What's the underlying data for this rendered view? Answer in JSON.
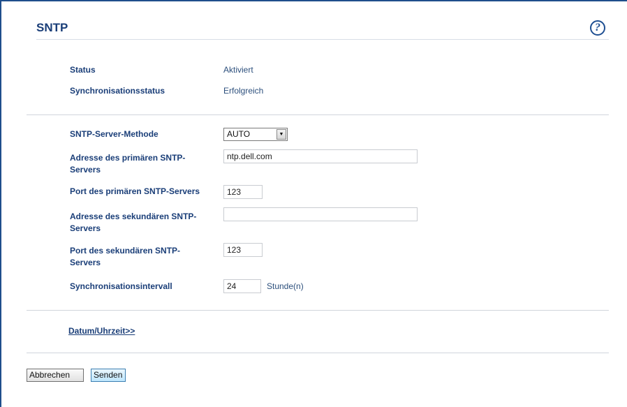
{
  "page": {
    "title": "SNTP",
    "help_icon": "question-circle-icon",
    "help_glyph": "?"
  },
  "status_section": {
    "status_label": "Status",
    "status_value": "Aktiviert",
    "sync_status_label": "Synchronisationsstatus",
    "sync_status_value": "Erfolgreich"
  },
  "form": {
    "method_label": "SNTP-Server-Methode",
    "method_value": "AUTO",
    "primary_address_label_1": "Adresse des primären SNTP-",
    "primary_address_label_2": "Servers",
    "primary_address_value": "ntp.dell.com",
    "primary_port_label": "Port des primären SNTP-Servers",
    "primary_port_value": "123",
    "secondary_address_label_1": "Adresse des sekundären SNTP-",
    "secondary_address_label_2": "Servers",
    "secondary_address_value": "",
    "secondary_port_label_1": "Port des sekundären SNTP-",
    "secondary_port_label_2": "Servers",
    "secondary_port_value": "123",
    "interval_label": "Synchronisationsintervall",
    "interval_value": "24",
    "interval_unit": "Stunde(n)"
  },
  "links": {
    "datetime": "Datum/Uhrzeit>>"
  },
  "buttons": {
    "cancel": "Abbrechen",
    "send": "Senden"
  }
}
